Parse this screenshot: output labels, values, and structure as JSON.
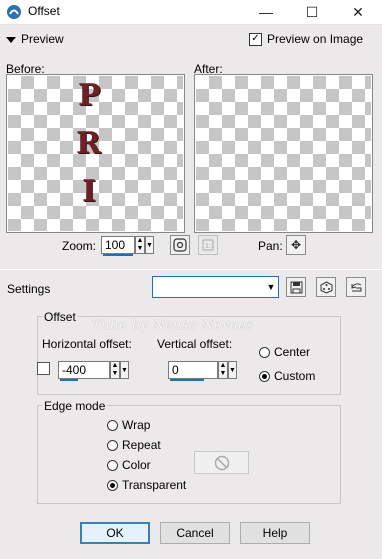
{
  "window": {
    "title": "Offset",
    "controls": {
      "minimize": "—",
      "maximize": "☐",
      "close": "✕"
    }
  },
  "preview": {
    "header": "Preview",
    "preview_on_image_label": "Preview on Image",
    "preview_on_image_checked": true,
    "before_label": "Before:",
    "after_label": "After:",
    "before_letters": [
      "P",
      "R",
      "I"
    ]
  },
  "zoom": {
    "label": "Zoom:",
    "value": "100",
    "pan_label": "Pan:"
  },
  "settings": {
    "label": "Settings",
    "value": ""
  },
  "offset": {
    "group_title": "Offset",
    "horizontal_label": "Horizontal offset:",
    "horizontal_value": "-400",
    "vertical_label": "Vertical offset:",
    "vertical_value": "0",
    "center_label": "Center",
    "custom_label": "Custom",
    "selected": "Custom",
    "watermark": "Tube by Neusa Novaes"
  },
  "edge_mode": {
    "group_title": "Edge mode",
    "options": [
      "Wrap",
      "Repeat",
      "Color",
      "Transparent"
    ],
    "selected": "Transparent"
  },
  "buttons": {
    "ok": "OK",
    "cancel": "Cancel",
    "help": "Help"
  }
}
